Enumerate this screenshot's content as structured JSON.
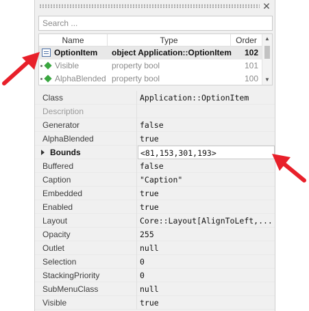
{
  "search": {
    "placeholder": "Search ..."
  },
  "list": {
    "columns": [
      "Name",
      "Type",
      "Order"
    ],
    "rows": [
      {
        "name": "OptionItem",
        "type": "object Application::OptionItem",
        "order": "102"
      },
      {
        "name": "Visible",
        "type": "property bool",
        "order": "101"
      },
      {
        "name": "AlphaBlended",
        "type": "property bool",
        "order": "100"
      }
    ]
  },
  "properties": [
    {
      "name": "Class",
      "value": "Application::OptionItem"
    },
    {
      "name": "Description",
      "value": ""
    },
    {
      "name": "Generator",
      "value": "false"
    },
    {
      "name": "AlphaBlended",
      "value": "true"
    },
    {
      "name": "Bounds",
      "value": "<81,153,301,193>"
    },
    {
      "name": "Buffered",
      "value": "false"
    },
    {
      "name": "Caption",
      "value": "\"Caption\""
    },
    {
      "name": "Embedded",
      "value": "true"
    },
    {
      "name": "Enabled",
      "value": "true"
    },
    {
      "name": "Layout",
      "value": "Core::Layout[AlignToLeft,..."
    },
    {
      "name": "Opacity",
      "value": "255"
    },
    {
      "name": "Outlet",
      "value": "null"
    },
    {
      "name": "Selection",
      "value": "0"
    },
    {
      "name": "StackingPriority",
      "value": "0"
    },
    {
      "name": "SubMenuClass",
      "value": "null"
    },
    {
      "name": "Visible",
      "value": "true"
    }
  ],
  "colors": {
    "callout_arrow": "#e8202a",
    "diamond_icon": "#3aa640"
  },
  "icons": {
    "close": "close-icon",
    "item": "option-item-icon",
    "property": "diamond-icon",
    "expand": "expand-triangle-icon"
  }
}
